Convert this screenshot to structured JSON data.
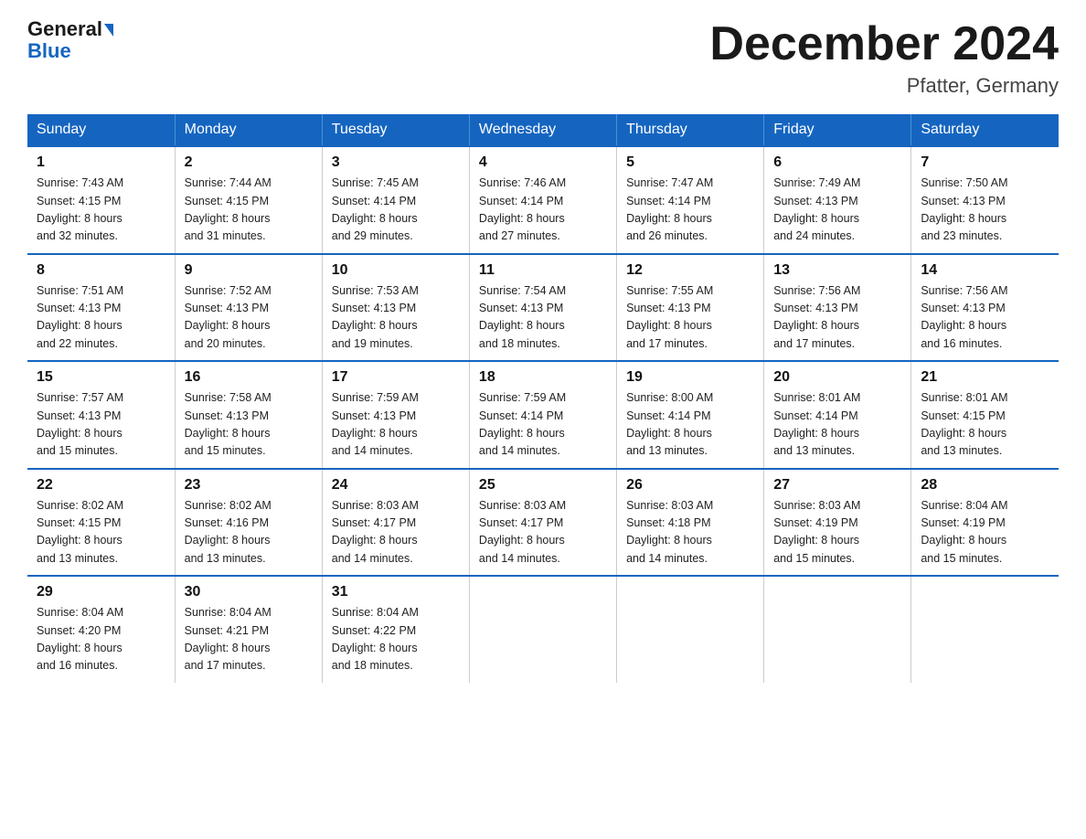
{
  "header": {
    "logo_general": "General",
    "logo_blue": "Blue",
    "month_year": "December 2024",
    "location": "Pfatter, Germany"
  },
  "weekdays": [
    "Sunday",
    "Monday",
    "Tuesday",
    "Wednesday",
    "Thursday",
    "Friday",
    "Saturday"
  ],
  "weeks": [
    [
      {
        "day": 1,
        "sunrise": "7:43 AM",
        "sunset": "4:15 PM",
        "daylight": "8 hours and 32 minutes."
      },
      {
        "day": 2,
        "sunrise": "7:44 AM",
        "sunset": "4:15 PM",
        "daylight": "8 hours and 31 minutes."
      },
      {
        "day": 3,
        "sunrise": "7:45 AM",
        "sunset": "4:14 PM",
        "daylight": "8 hours and 29 minutes."
      },
      {
        "day": 4,
        "sunrise": "7:46 AM",
        "sunset": "4:14 PM",
        "daylight": "8 hours and 27 minutes."
      },
      {
        "day": 5,
        "sunrise": "7:47 AM",
        "sunset": "4:14 PM",
        "daylight": "8 hours and 26 minutes."
      },
      {
        "day": 6,
        "sunrise": "7:49 AM",
        "sunset": "4:13 PM",
        "daylight": "8 hours and 24 minutes."
      },
      {
        "day": 7,
        "sunrise": "7:50 AM",
        "sunset": "4:13 PM",
        "daylight": "8 hours and 23 minutes."
      }
    ],
    [
      {
        "day": 8,
        "sunrise": "7:51 AM",
        "sunset": "4:13 PM",
        "daylight": "8 hours and 22 minutes."
      },
      {
        "day": 9,
        "sunrise": "7:52 AM",
        "sunset": "4:13 PM",
        "daylight": "8 hours and 20 minutes."
      },
      {
        "day": 10,
        "sunrise": "7:53 AM",
        "sunset": "4:13 PM",
        "daylight": "8 hours and 19 minutes."
      },
      {
        "day": 11,
        "sunrise": "7:54 AM",
        "sunset": "4:13 PM",
        "daylight": "8 hours and 18 minutes."
      },
      {
        "day": 12,
        "sunrise": "7:55 AM",
        "sunset": "4:13 PM",
        "daylight": "8 hours and 17 minutes."
      },
      {
        "day": 13,
        "sunrise": "7:56 AM",
        "sunset": "4:13 PM",
        "daylight": "8 hours and 17 minutes."
      },
      {
        "day": 14,
        "sunrise": "7:56 AM",
        "sunset": "4:13 PM",
        "daylight": "8 hours and 16 minutes."
      }
    ],
    [
      {
        "day": 15,
        "sunrise": "7:57 AM",
        "sunset": "4:13 PM",
        "daylight": "8 hours and 15 minutes."
      },
      {
        "day": 16,
        "sunrise": "7:58 AM",
        "sunset": "4:13 PM",
        "daylight": "8 hours and 15 minutes."
      },
      {
        "day": 17,
        "sunrise": "7:59 AM",
        "sunset": "4:13 PM",
        "daylight": "8 hours and 14 minutes."
      },
      {
        "day": 18,
        "sunrise": "7:59 AM",
        "sunset": "4:14 PM",
        "daylight": "8 hours and 14 minutes."
      },
      {
        "day": 19,
        "sunrise": "8:00 AM",
        "sunset": "4:14 PM",
        "daylight": "8 hours and 13 minutes."
      },
      {
        "day": 20,
        "sunrise": "8:01 AM",
        "sunset": "4:14 PM",
        "daylight": "8 hours and 13 minutes."
      },
      {
        "day": 21,
        "sunrise": "8:01 AM",
        "sunset": "4:15 PM",
        "daylight": "8 hours and 13 minutes."
      }
    ],
    [
      {
        "day": 22,
        "sunrise": "8:02 AM",
        "sunset": "4:15 PM",
        "daylight": "8 hours and 13 minutes."
      },
      {
        "day": 23,
        "sunrise": "8:02 AM",
        "sunset": "4:16 PM",
        "daylight": "8 hours and 13 minutes."
      },
      {
        "day": 24,
        "sunrise": "8:03 AM",
        "sunset": "4:17 PM",
        "daylight": "8 hours and 14 minutes."
      },
      {
        "day": 25,
        "sunrise": "8:03 AM",
        "sunset": "4:17 PM",
        "daylight": "8 hours and 14 minutes."
      },
      {
        "day": 26,
        "sunrise": "8:03 AM",
        "sunset": "4:18 PM",
        "daylight": "8 hours and 14 minutes."
      },
      {
        "day": 27,
        "sunrise": "8:03 AM",
        "sunset": "4:19 PM",
        "daylight": "8 hours and 15 minutes."
      },
      {
        "day": 28,
        "sunrise": "8:04 AM",
        "sunset": "4:19 PM",
        "daylight": "8 hours and 15 minutes."
      }
    ],
    [
      {
        "day": 29,
        "sunrise": "8:04 AM",
        "sunset": "4:20 PM",
        "daylight": "8 hours and 16 minutes."
      },
      {
        "day": 30,
        "sunrise": "8:04 AM",
        "sunset": "4:21 PM",
        "daylight": "8 hours and 17 minutes."
      },
      {
        "day": 31,
        "sunrise": "8:04 AM",
        "sunset": "4:22 PM",
        "daylight": "8 hours and 18 minutes."
      },
      null,
      null,
      null,
      null
    ]
  ]
}
